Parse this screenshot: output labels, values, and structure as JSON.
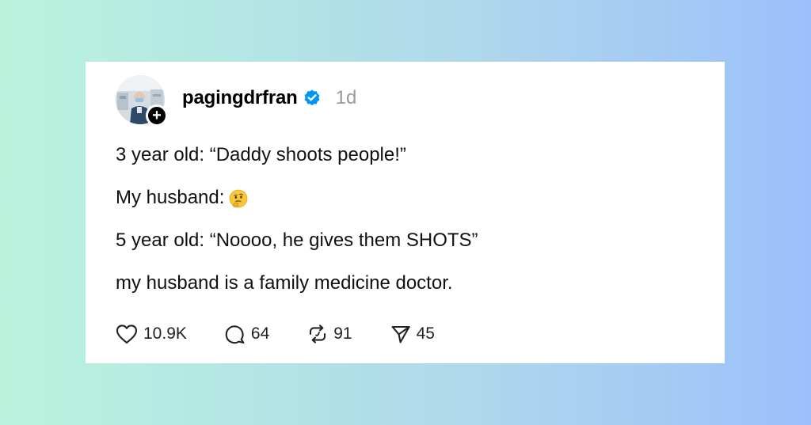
{
  "post": {
    "username": "pagingdrfran",
    "timestamp": "1d",
    "lines": [
      "3 year old: “Daddy shoots people!”",
      "My husband:",
      "5 year old: “Noooo, he gives them SHOTS”",
      "my husband is a family medicine doctor."
    ],
    "emoji": "thinking-face-icon",
    "follow_badge": "+"
  },
  "actions": {
    "likes": "10.9K",
    "replies": "64",
    "reposts": "91",
    "shares": "45"
  },
  "colors": {
    "verified": "#0095f6",
    "timestamp": "#9a9a9a",
    "card": "#ffffff"
  }
}
